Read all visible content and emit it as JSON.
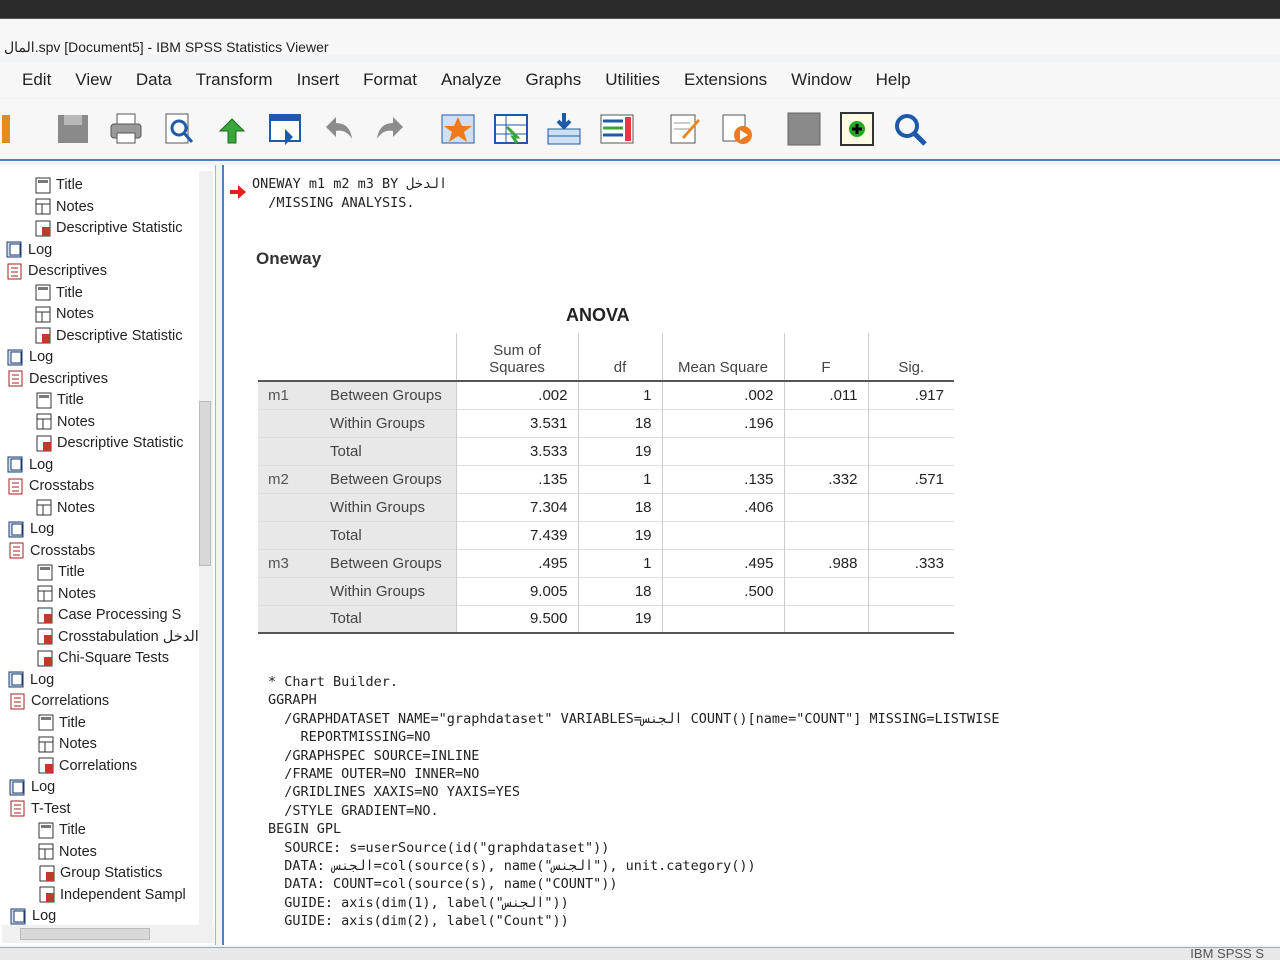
{
  "window": {
    "title": "المال.spv [Document5] - IBM SPSS Statistics Viewer"
  },
  "menu": [
    "Edit",
    "View",
    "Data",
    "Transform",
    "Insert",
    "Format",
    "Analyze",
    "Graphs",
    "Utilities",
    "Extensions",
    "Window",
    "Help"
  ],
  "toolbar": {
    "icons": [
      "save-icon",
      "print-icon",
      "print-preview-icon",
      "export-icon",
      "recall-dialog-icon",
      "undo-icon",
      "redo-icon",
      "goto-data-icon",
      "goto-case-icon",
      "variables-icon",
      "insert-output-icon",
      "designate-window-icon",
      "run-script-icon",
      "select-icon",
      "create-icon",
      "search-icon"
    ]
  },
  "outline": {
    "items": [
      {
        "label": "Title",
        "level": 3
      },
      {
        "label": "Notes",
        "level": 3
      },
      {
        "label": "Descriptive Statistic",
        "level": 3
      },
      {
        "label": "Log",
        "level": 1
      },
      {
        "label": "Descriptives",
        "level": 1
      },
      {
        "label": "Title",
        "level": 3
      },
      {
        "label": "Notes",
        "level": 3
      },
      {
        "label": "Descriptive Statistic",
        "level": 3
      },
      {
        "label": "Log",
        "level": 1
      },
      {
        "label": "Descriptives",
        "level": 1
      },
      {
        "label": "Title",
        "level": 3
      },
      {
        "label": "Notes",
        "level": 3
      },
      {
        "label": "Descriptive Statistic",
        "level": 3
      },
      {
        "label": "Log",
        "level": 1
      },
      {
        "label": "Crosstabs",
        "level": 1
      },
      {
        "label": "Notes",
        "level": 3
      },
      {
        "label": "Log",
        "level": 1
      },
      {
        "label": "Crosstabs",
        "level": 1
      },
      {
        "label": "Title",
        "level": 3
      },
      {
        "label": "Notes",
        "level": 3
      },
      {
        "label": "Case Processing S",
        "level": 3
      },
      {
        "label": "Crosstabulation الدخل",
        "level": 3
      },
      {
        "label": "Chi-Square Tests",
        "level": 3
      },
      {
        "label": "Log",
        "level": 1
      },
      {
        "label": "Correlations",
        "level": 1
      },
      {
        "label": "Title",
        "level": 3
      },
      {
        "label": "Notes",
        "level": 3
      },
      {
        "label": "Correlations",
        "level": 3
      },
      {
        "label": "Log",
        "level": 1
      },
      {
        "label": "T-Test",
        "level": 1
      },
      {
        "label": "Title",
        "level": 3
      },
      {
        "label": "Notes",
        "level": 3
      },
      {
        "label": "Group Statistics",
        "level": 3
      },
      {
        "label": "Independent Sampl",
        "level": 3
      },
      {
        "label": "Log",
        "level": 1
      }
    ]
  },
  "syntax_top": [
    "ONEWAY m1 m2 m3 BY الدخل",
    "  /MISSING ANALYSIS."
  ],
  "heading": "Oneway",
  "anova": {
    "title": "ANOVA",
    "headers": [
      "Sum of\nSquares",
      "df",
      "Mean Square",
      "F",
      "Sig."
    ],
    "rows": [
      {
        "var": "m1",
        "group": "Between Groups",
        "ss": ".002",
        "df": "1",
        "ms": ".002",
        "f": ".011",
        "sig": ".917"
      },
      {
        "var": "",
        "group": "Within Groups",
        "ss": "3.531",
        "df": "18",
        "ms": ".196",
        "f": "",
        "sig": ""
      },
      {
        "var": "",
        "group": "Total",
        "ss": "3.533",
        "df": "19",
        "ms": "",
        "f": "",
        "sig": ""
      },
      {
        "var": "m2",
        "group": "Between Groups",
        "ss": ".135",
        "df": "1",
        "ms": ".135",
        "f": ".332",
        "sig": ".571"
      },
      {
        "var": "",
        "group": "Within Groups",
        "ss": "7.304",
        "df": "18",
        "ms": ".406",
        "f": "",
        "sig": ""
      },
      {
        "var": "",
        "group": "Total",
        "ss": "7.439",
        "df": "19",
        "ms": "",
        "f": "",
        "sig": ""
      },
      {
        "var": "m3",
        "group": "Between Groups",
        "ss": ".495",
        "df": "1",
        "ms": ".495",
        "f": ".988",
        "sig": ".333"
      },
      {
        "var": "",
        "group": "Within Groups",
        "ss": "9.005",
        "df": "18",
        "ms": ".500",
        "f": "",
        "sig": ""
      },
      {
        "var": "",
        "group": "Total",
        "ss": "9.500",
        "df": "19",
        "ms": "",
        "f": "",
        "sig": ""
      }
    ]
  },
  "syntax_bottom": [
    "* Chart Builder.",
    "GGRAPH",
    "  /GRAPHDATASET NAME=\"graphdataset\" VARIABLES=الجنس COUNT()[name=\"COUNT\"] MISSING=LISTWISE",
    "    REPORTMISSING=NO",
    "  /GRAPHSPEC SOURCE=INLINE",
    "  /FRAME OUTER=NO INNER=NO",
    "  /GRIDLINES XAXIS=NO YAXIS=YES",
    "  /STYLE GRADIENT=NO.",
    "BEGIN GPL",
    "  SOURCE: s=userSource(id(\"graphdataset\"))",
    "  DATA: الجنس=col(source(s), name(\"الجنس\"), unit.category())",
    "  DATA: COUNT=col(source(s), name(\"COUNT\"))",
    "  GUIDE: axis(dim(1), label(\"الجنس\"))",
    "  GUIDE: axis(dim(2), label(\"Count\"))"
  ],
  "status": "IBM SPSS S"
}
